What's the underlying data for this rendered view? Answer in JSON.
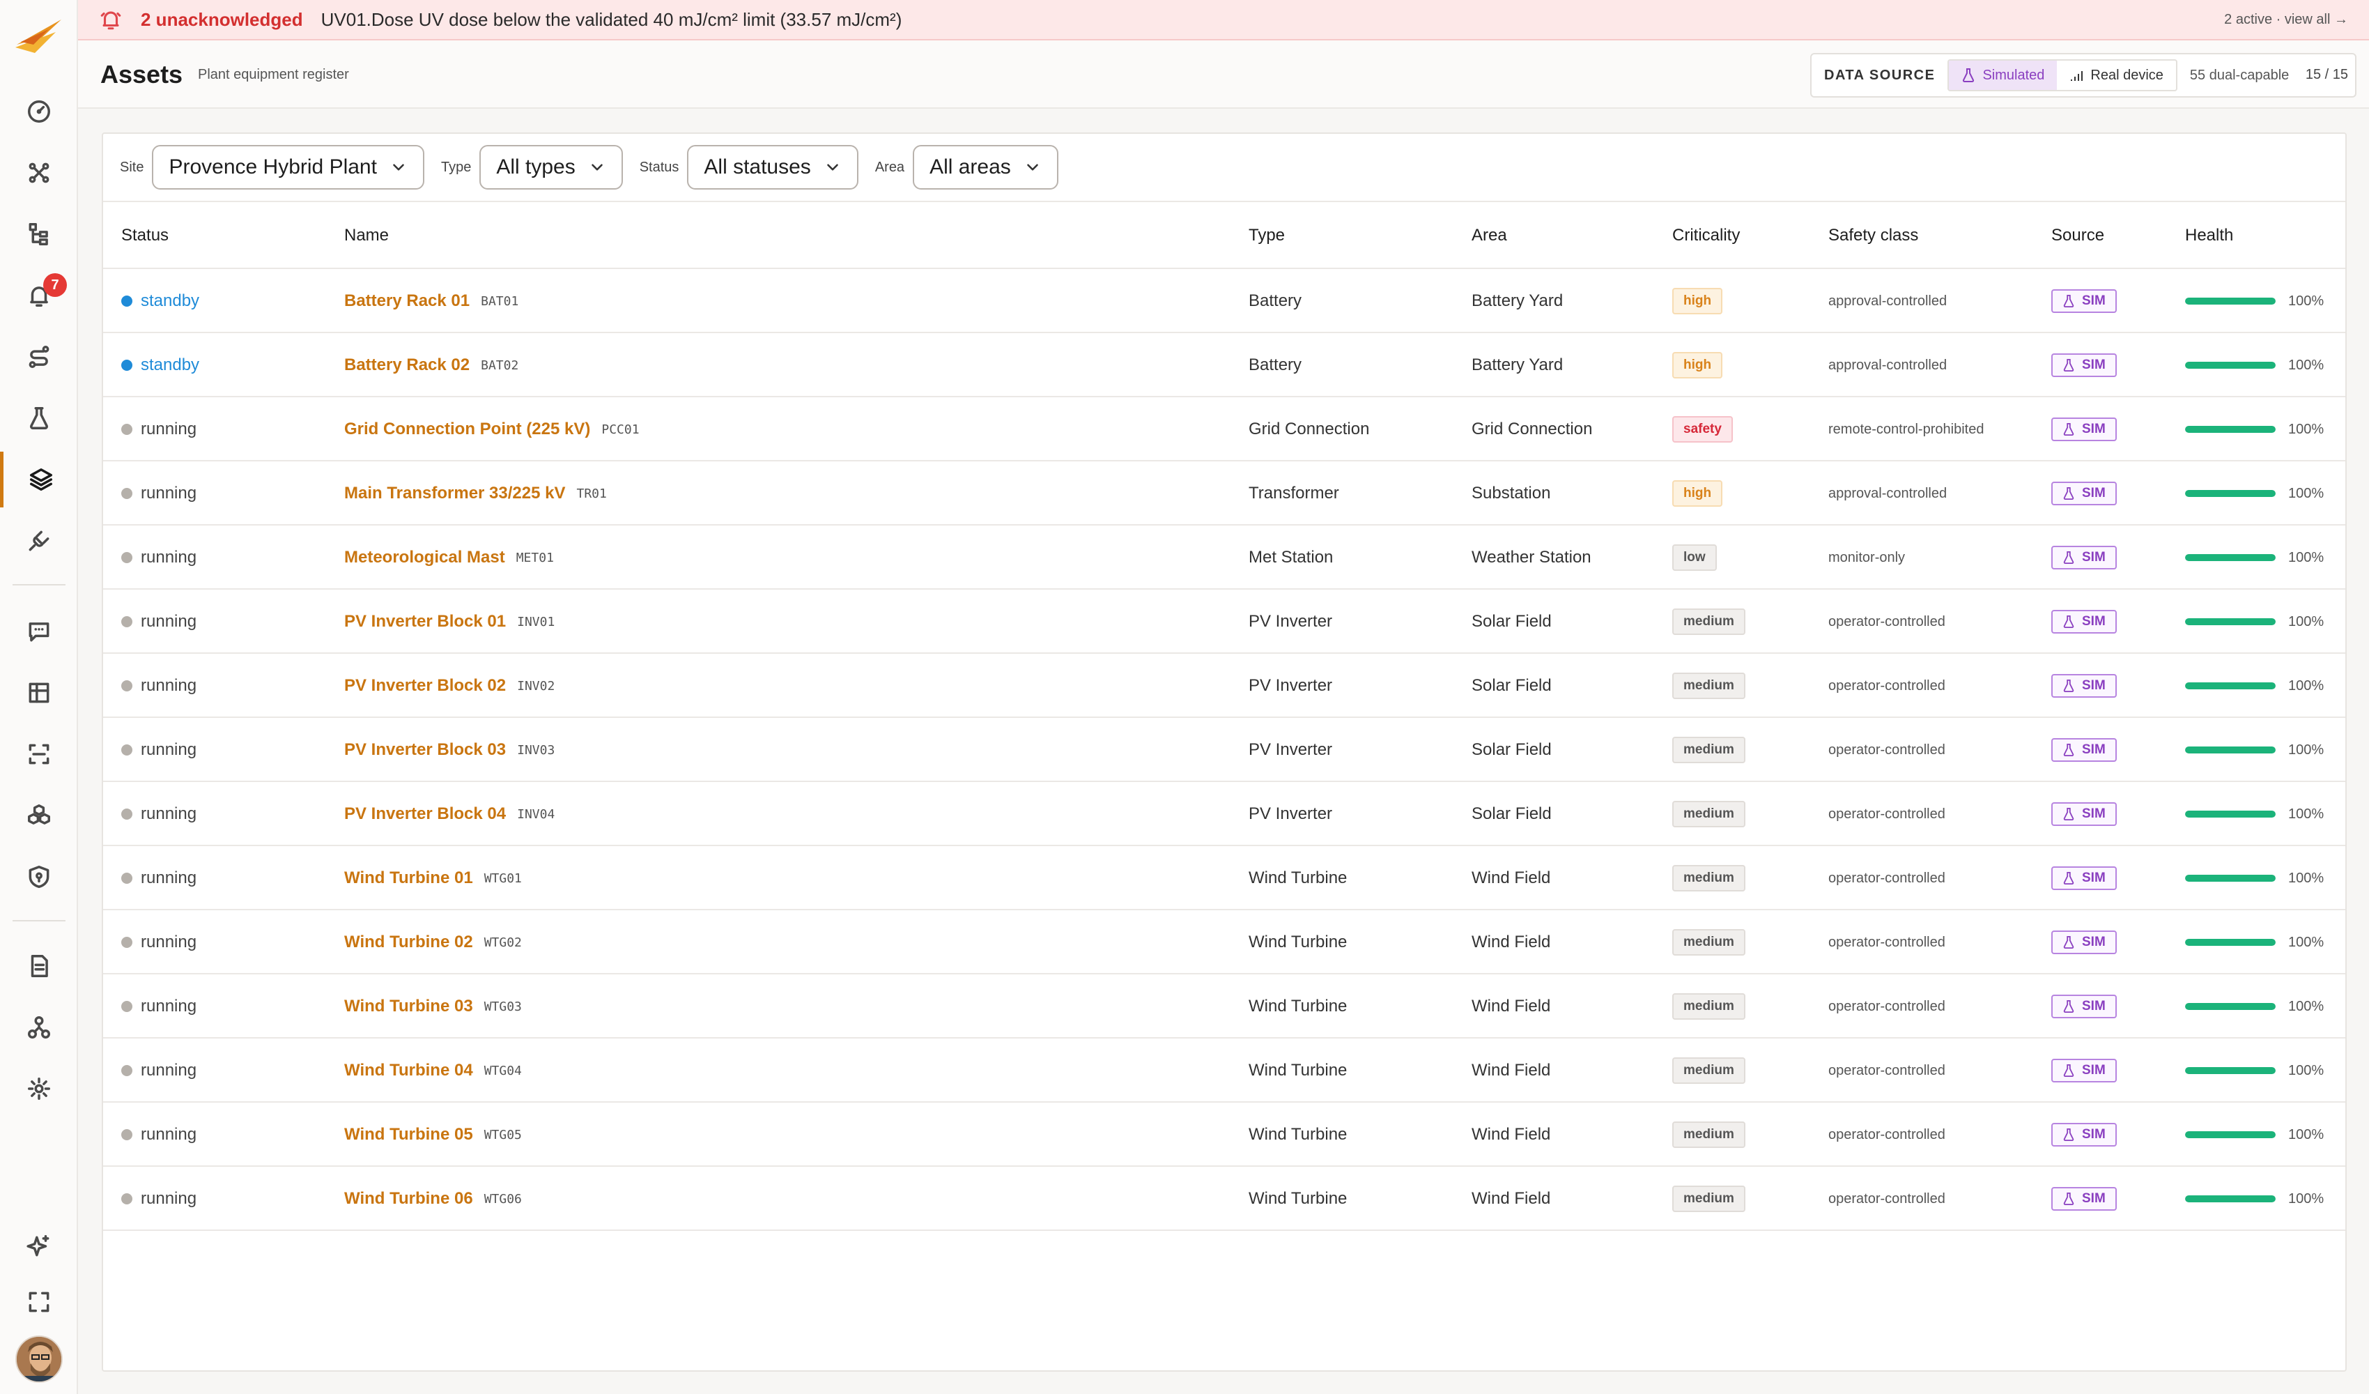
{
  "alert": {
    "count_text": "2 unacknowledged",
    "message": "UV01.Dose UV dose below the validated 40 mJ/cm² limit (33.57 mJ/cm²)",
    "right_text": "2 active · view all →"
  },
  "sidebar": {
    "alerts_badge": "7",
    "items": [
      {
        "name": "dashboard"
      },
      {
        "name": "topology"
      },
      {
        "name": "hierarchy"
      },
      {
        "name": "alarms"
      },
      {
        "name": "workflows"
      },
      {
        "name": "lab"
      },
      {
        "name": "assets"
      },
      {
        "name": "integrations"
      },
      {
        "name": "chat"
      },
      {
        "name": "tables"
      },
      {
        "name": "scan"
      },
      {
        "name": "models"
      },
      {
        "name": "security"
      },
      {
        "name": "documents"
      },
      {
        "name": "organization"
      },
      {
        "name": "settings"
      },
      {
        "name": "ai-assistant"
      },
      {
        "name": "fullscreen"
      }
    ]
  },
  "header": {
    "title": "Assets",
    "subtitle": "Plant equipment register",
    "data_source_label": "DATA SOURCE",
    "simulated_label": "Simulated",
    "real_device_label": "Real device",
    "dual_capable": "55 dual-capable",
    "page_count": "15 / 15"
  },
  "filters": {
    "site_label": "Site",
    "site_value": "Provence Hybrid Plant",
    "type_label": "Type",
    "type_value": "All types",
    "status_label": "Status",
    "status_value": "All statuses",
    "area_label": "Area",
    "area_value": "All areas"
  },
  "table": {
    "columns": [
      "Status",
      "Name",
      "Type",
      "Area",
      "Criticality",
      "Safety class",
      "Source",
      "Health"
    ],
    "rows": [
      {
        "status": "standby",
        "name": "Battery Rack 01",
        "code": "BAT01",
        "type": "Battery",
        "area": "Battery Yard",
        "criticality": "high",
        "safety_class": "approval-controlled",
        "source": "SIM",
        "health": 100,
        "health_text": "100%"
      },
      {
        "status": "standby",
        "name": "Battery Rack 02",
        "code": "BAT02",
        "type": "Battery",
        "area": "Battery Yard",
        "criticality": "high",
        "safety_class": "approval-controlled",
        "source": "SIM",
        "health": 100,
        "health_text": "100%"
      },
      {
        "status": "running",
        "name": "Grid Connection Point (225 kV)",
        "code": "PCC01",
        "type": "Grid Connection",
        "area": "Grid Connection",
        "criticality": "safety",
        "safety_class": "remote-control-prohibited",
        "source": "SIM",
        "health": 100,
        "health_text": "100%"
      },
      {
        "status": "running",
        "name": "Main Transformer 33/225 kV",
        "code": "TR01",
        "type": "Transformer",
        "area": "Substation",
        "criticality": "high",
        "safety_class": "approval-controlled",
        "source": "SIM",
        "health": 100,
        "health_text": "100%"
      },
      {
        "status": "running",
        "name": "Meteorological Mast",
        "code": "MET01",
        "type": "Met Station",
        "area": "Weather Station",
        "criticality": "low",
        "safety_class": "monitor-only",
        "source": "SIM",
        "health": 100,
        "health_text": "100%"
      },
      {
        "status": "running",
        "name": "PV Inverter Block 01",
        "code": "INV01",
        "type": "PV Inverter",
        "area": "Solar Field",
        "criticality": "medium",
        "safety_class": "operator-controlled",
        "source": "SIM",
        "health": 100,
        "health_text": "100%"
      },
      {
        "status": "running",
        "name": "PV Inverter Block 02",
        "code": "INV02",
        "type": "PV Inverter",
        "area": "Solar Field",
        "criticality": "medium",
        "safety_class": "operator-controlled",
        "source": "SIM",
        "health": 100,
        "health_text": "100%"
      },
      {
        "status": "running",
        "name": "PV Inverter Block 03",
        "code": "INV03",
        "type": "PV Inverter",
        "area": "Solar Field",
        "criticality": "medium",
        "safety_class": "operator-controlled",
        "source": "SIM",
        "health": 100,
        "health_text": "100%"
      },
      {
        "status": "running",
        "name": "PV Inverter Block 04",
        "code": "INV04",
        "type": "PV Inverter",
        "area": "Solar Field",
        "criticality": "medium",
        "safety_class": "operator-controlled",
        "source": "SIM",
        "health": 100,
        "health_text": "100%"
      },
      {
        "status": "running",
        "name": "Wind Turbine 01",
        "code": "WTG01",
        "type": "Wind Turbine",
        "area": "Wind Field",
        "criticality": "medium",
        "safety_class": "operator-controlled",
        "source": "SIM",
        "health": 100,
        "health_text": "100%"
      },
      {
        "status": "running",
        "name": "Wind Turbine 02",
        "code": "WTG02",
        "type": "Wind Turbine",
        "area": "Wind Field",
        "criticality": "medium",
        "safety_class": "operator-controlled",
        "source": "SIM",
        "health": 100,
        "health_text": "100%"
      },
      {
        "status": "running",
        "name": "Wind Turbine 03",
        "code": "WTG03",
        "type": "Wind Turbine",
        "area": "Wind Field",
        "criticality": "medium",
        "safety_class": "operator-controlled",
        "source": "SIM",
        "health": 100,
        "health_text": "100%"
      },
      {
        "status": "running",
        "name": "Wind Turbine 04",
        "code": "WTG04",
        "type": "Wind Turbine",
        "area": "Wind Field",
        "criticality": "medium",
        "safety_class": "operator-controlled",
        "source": "SIM",
        "health": 100,
        "health_text": "100%"
      },
      {
        "status": "running",
        "name": "Wind Turbine 05",
        "code": "WTG05",
        "type": "Wind Turbine",
        "area": "Wind Field",
        "criticality": "medium",
        "safety_class": "operator-controlled",
        "source": "SIM",
        "health": 100,
        "health_text": "100%"
      },
      {
        "status": "running",
        "name": "Wind Turbine 06",
        "code": "WTG06",
        "type": "Wind Turbine",
        "area": "Wind Field",
        "criticality": "medium",
        "safety_class": "operator-controlled",
        "source": "SIM",
        "health": 100,
        "health_text": "100%"
      }
    ]
  },
  "colors": {
    "accent": "#c97510",
    "standby": "#1f8bd8",
    "running": "#b5b0aa",
    "health": "#1bb37a",
    "sim": "#8a3fc0",
    "alert": "#d32f2f"
  }
}
